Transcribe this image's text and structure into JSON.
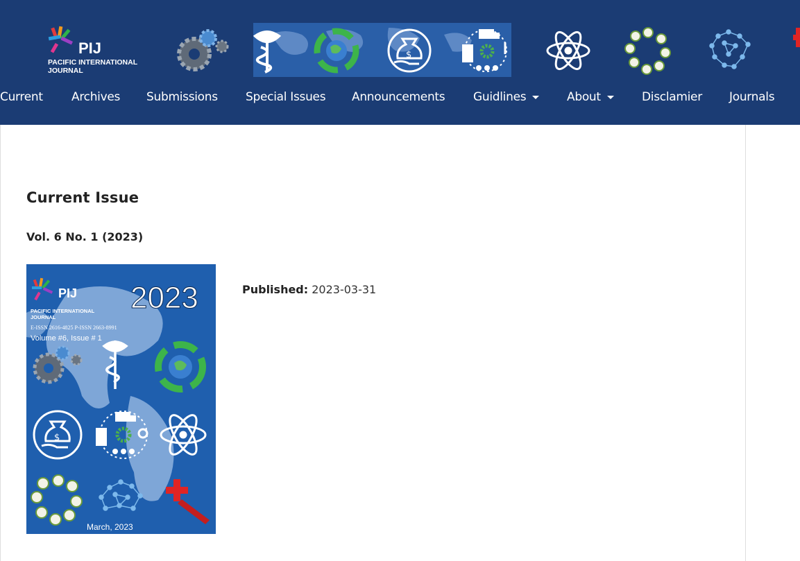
{
  "header": {
    "logo": {
      "abbr": "PIJ",
      "name_line1": "PACIFIC INTERNATIONAL",
      "name_line2": "JOURNAL"
    },
    "colors": {
      "header_bg": "#1b3c74",
      "banner_map": "#2a5fa8"
    },
    "banner_icons": [
      "gears-icon",
      "caduceus-icon",
      "recycle-globe-icon",
      "money-bag-icon",
      "logistics-icon",
      "atom-icon",
      "agriculture-circle-icon",
      "brain-network-icon",
      "medical-cross-icon"
    ]
  },
  "nav": {
    "items": [
      {
        "label": "Current"
      },
      {
        "label": "Archives"
      },
      {
        "label": "Submissions"
      },
      {
        "label": "Special Issues"
      },
      {
        "label": "Announcements"
      },
      {
        "label": "Guidlines"
      },
      {
        "label": "About"
      },
      {
        "label": "Disclamier"
      },
      {
        "label": "Journals"
      }
    ]
  },
  "main": {
    "title": "Current Issue",
    "issue": "Vol. 6 No. 1 (2023)",
    "published_label": "Published:",
    "published_date": "2023-03-31",
    "cover": {
      "year": "2023",
      "issn": "E-ISSN 2616-4825    P-ISSN 2663-8991",
      "volume": "Volume #6, Issue # 1",
      "date": "March, 2023",
      "colors": {
        "bg": "#1f5fae",
        "land": "#8fb3de"
      }
    }
  }
}
